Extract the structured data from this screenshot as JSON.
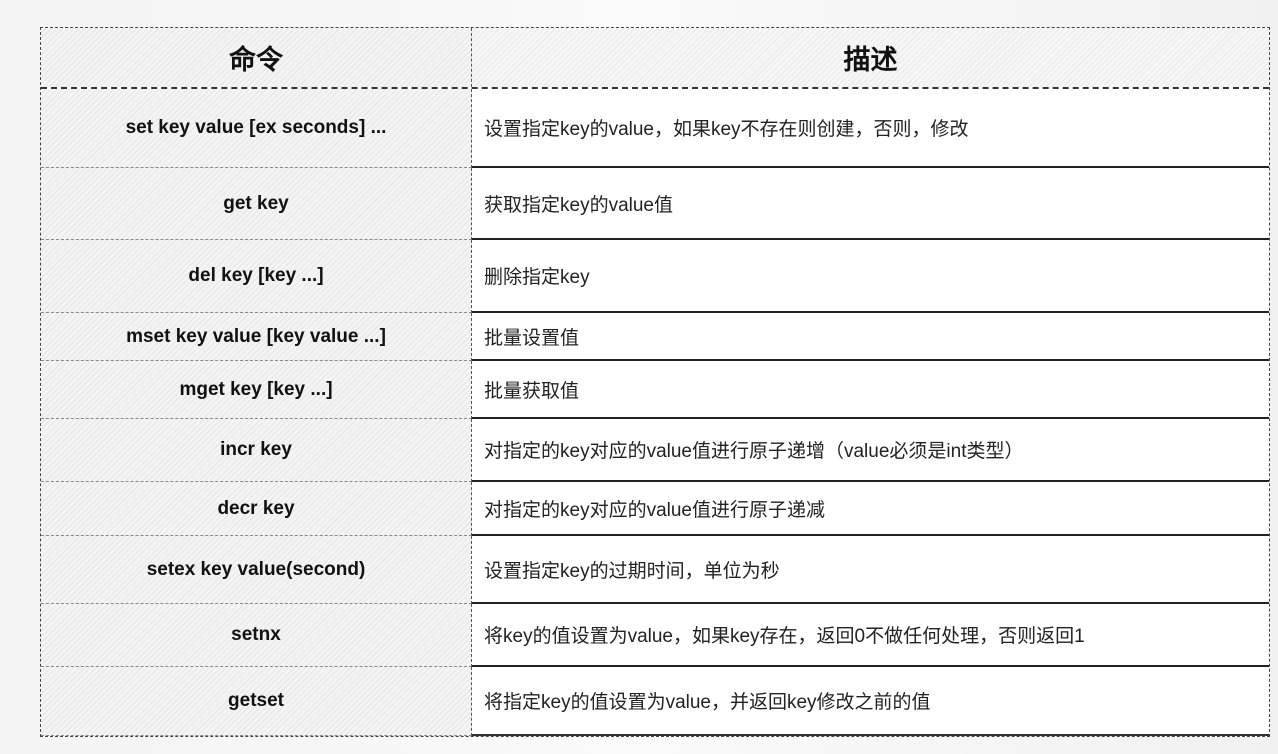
{
  "table": {
    "headers": {
      "command": "命令",
      "description": "描述"
    },
    "rows": [
      {
        "command": "set key value [ex seconds] ...",
        "description": "设置指定key的value，如果key不存在则创建，否则，修改"
      },
      {
        "command": "get key",
        "description": "获取指定key的value值"
      },
      {
        "command": "del key [key ...]",
        "description": "删除指定key"
      },
      {
        "command": "mset key value [key value ...]",
        "description": "批量设置值"
      },
      {
        "command": "mget key [key ...]",
        "description": "批量获取值"
      },
      {
        "command": "incr key",
        "description": "对指定的key对应的value值进行原子递增（value必须是int类型）"
      },
      {
        "command": "decr key",
        "description": "对指定的key对应的value值进行原子递减"
      },
      {
        "command": "setex key  value(second)",
        "description": "设置指定key的过期时间，单位为秒"
      },
      {
        "command": "setnx",
        "description": "将key的值设置为value，如果key存在，返回0不做任何处理，否则返回1"
      },
      {
        "command": "getset",
        "description": "将指定key的值设置为value，并返回key修改之前的值"
      }
    ]
  }
}
